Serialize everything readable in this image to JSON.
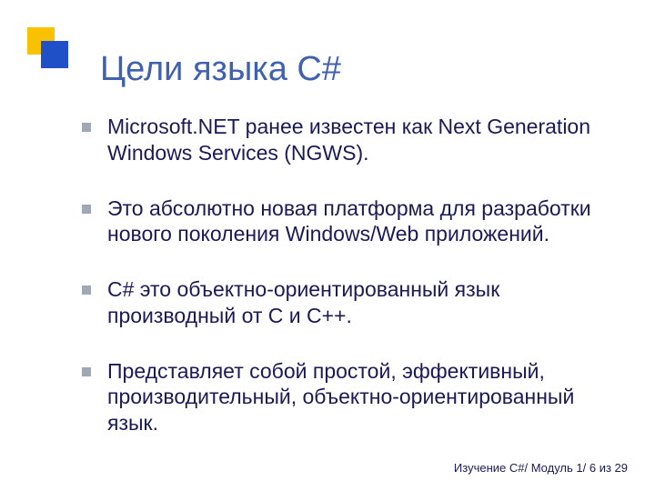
{
  "title": "Цели языка C#",
  "bullets": [
    "Microsoft.NET ранее известен как Next Generation Windows Services (NGWS).",
    "Это абсолютно новая платформа для разработки нового поколения Windows/Web приложений.",
    "C# это объектно-ориентированный язык производный от C и C++.",
    "Представляет собой простой, эффективный, производительный, объектно-ориентированный язык."
  ],
  "footer": "Изучение C#/ Модуль 1/ 6 из 29"
}
